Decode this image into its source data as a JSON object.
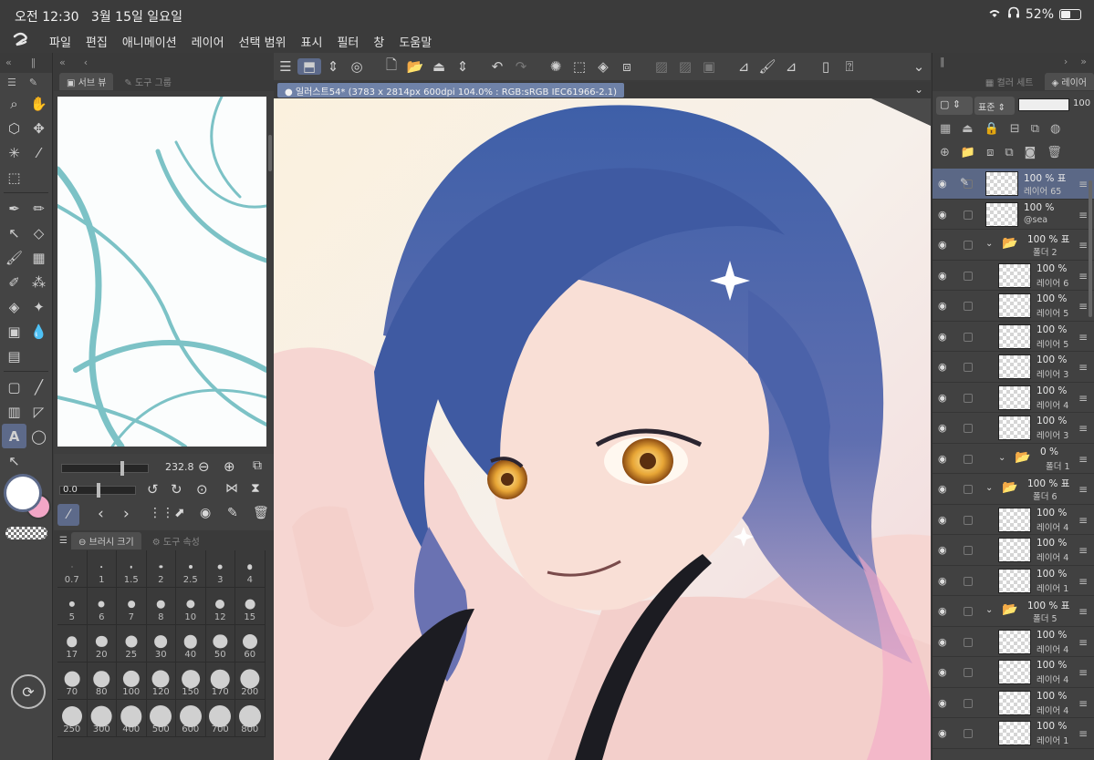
{
  "status": {
    "time": "오전 12:30",
    "date": "3월 15일 일요일",
    "battery": "52%",
    "wifi_icon": "wifi-icon",
    "headphones_icon": "headphones-icon",
    "battery_level": 0.52
  },
  "menu": [
    "파일",
    "편집",
    "애니메이션",
    "레이어",
    "선택 범위",
    "표시",
    "필터",
    "창",
    "도움말"
  ],
  "subview": {
    "tab1": "서브 뷰",
    "tab2": "도구 그룹"
  },
  "brush": {
    "size_value": "232.8",
    "opacity_value": "0.0"
  },
  "sizes_panel": {
    "tab1": "브러시 크기",
    "tab2": "도구 속성",
    "values": [
      "0.7",
      "1",
      "1.5",
      "2",
      "2.5",
      "3",
      "4",
      "5",
      "6",
      "7",
      "8",
      "10",
      "12",
      "15",
      "17",
      "20",
      "25",
      "30",
      "40",
      "50",
      "60",
      "70",
      "80",
      "100",
      "120",
      "150",
      "170",
      "200",
      "250",
      "300",
      "400",
      "500",
      "600",
      "700",
      "800"
    ]
  },
  "document": {
    "tab_label": "일러스트54* (3783 x 2814px 600dpi 104.0% : RGB:sRGB IEC61966-2.1)"
  },
  "layer_panel": {
    "tab1": "컬러 세트",
    "tab2": "레이어",
    "blend_mode": "표준",
    "opacity": "100",
    "rows": [
      {
        "pct": "100 % 표",
        "name": "레이어 65",
        "selected": true
      },
      {
        "pct": "100 %",
        "name": "@sea"
      },
      {
        "pct": "100 % 표",
        "name": "폴더 2",
        "folder": true
      },
      {
        "pct": "100 %",
        "name": "레이어 6"
      },
      {
        "pct": "100 %",
        "name": "레이어 5"
      },
      {
        "pct": "100 %",
        "name": "레이어 5"
      },
      {
        "pct": "100 %",
        "name": "레이어 3"
      },
      {
        "pct": "100 %",
        "name": "레이어 4"
      },
      {
        "pct": "100 %",
        "name": "레이어 3"
      },
      {
        "pct": "0 %",
        "name": "폴더 1",
        "folder": true
      },
      {
        "pct": "100 % 표",
        "name": "폴더 6",
        "folder": true
      },
      {
        "pct": "100 %",
        "name": "레이어 4"
      },
      {
        "pct": "100 %",
        "name": "레이어 4"
      },
      {
        "pct": "100 %",
        "name": "레이어 1"
      },
      {
        "pct": "100 % 표",
        "name": "폴더 5",
        "folder": true
      },
      {
        "pct": "100 %",
        "name": "레이어 4"
      },
      {
        "pct": "100 %",
        "name": "레이어 4"
      },
      {
        "pct": "100 %",
        "name": "레이어 4"
      },
      {
        "pct": "100 %",
        "name": "레이어 1"
      }
    ]
  },
  "colors": {
    "main": "#ffffff",
    "sub": "#f2a6c6",
    "accent": "#5d6a8a"
  }
}
